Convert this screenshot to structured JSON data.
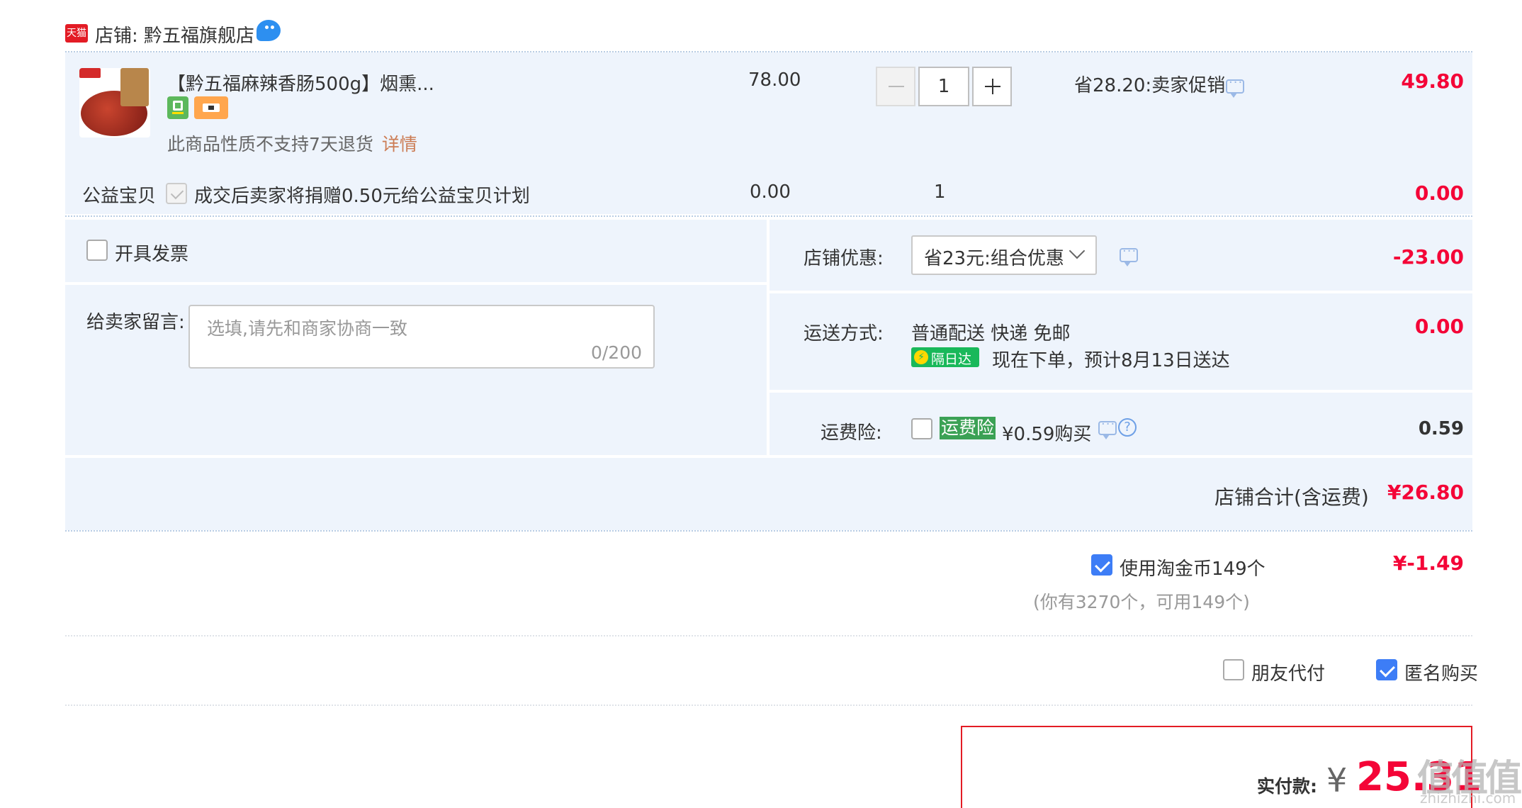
{
  "shop": {
    "badge": "天猫",
    "name": "店铺: 黔五福旗舰店"
  },
  "item": {
    "title": "【黔五福麻辣香肠500g】烟熏...",
    "unit_price": "78.00",
    "quantity": "1",
    "promo": "省28.20:卖家促销",
    "subtotal": "49.80",
    "no_return_note": "此商品性质不支持7天退货",
    "detail_link": "详情"
  },
  "charity": {
    "label": "公益宝贝",
    "text": "成交后卖家将捐赠0.50元给公益宝贝计划",
    "price": "0.00",
    "qty": "1",
    "amount": "0.00"
  },
  "invoice": {
    "label": "开具发票"
  },
  "message": {
    "label": "给卖家留言:",
    "placeholder": "选填,请先和商家协商一致",
    "counter": "0/200"
  },
  "discount": {
    "label": "店铺优惠:",
    "selected": "省23元:组合优惠",
    "amount": "-23.00"
  },
  "shipping": {
    "label": "运送方式:",
    "method": "普通配送 快递 免邮",
    "badge": "隔日达",
    "eta": "现在下单，预计8月13日送达",
    "amount": "0.00"
  },
  "insurance": {
    "label": "运费险:",
    "tag": "运费险",
    "price_text": "¥0.59购买",
    "amount": "0.59"
  },
  "shop_total": {
    "label": "店铺合计(含运费)",
    "amount": "¥26.80"
  },
  "coins": {
    "label": "使用淘金币149个",
    "note": "(你有3270个，可用149个)",
    "amount": "¥-1.49"
  },
  "options": {
    "friend_pay": "朋友代付",
    "anonymous": "匿名购买"
  },
  "pay": {
    "label": "实付款:",
    "currency": "¥",
    "amount": "25.31"
  },
  "watermark": {
    "text": "值值值",
    "url": "zhizhizhi.com"
  },
  "colors": {
    "price_red": "#f40537",
    "accent_blue": "#3d7df6",
    "panel_bg": "#eef4fc",
    "tmall_red": "#e31c25",
    "next_day_green": "#19b85a"
  }
}
